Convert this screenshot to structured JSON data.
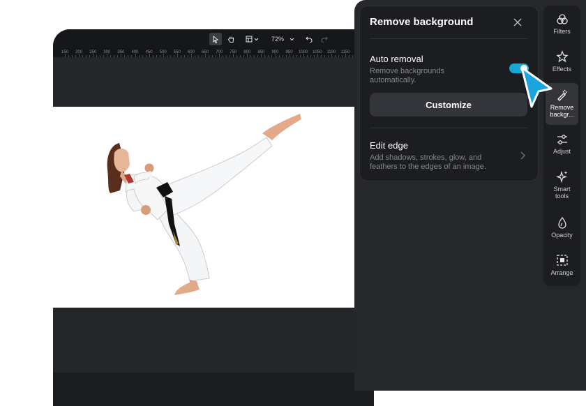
{
  "editor": {
    "zoom": "72%",
    "ruler_ticks": [
      "150",
      "200",
      "250",
      "300",
      "350",
      "400",
      "450",
      "500",
      "550",
      "600",
      "650",
      "700",
      "750",
      "800",
      "850",
      "900",
      "950",
      "1000",
      "1050",
      "1100",
      "1150"
    ]
  },
  "panel": {
    "title": "Remove background",
    "auto_removal": {
      "title": "Auto removal",
      "description_line1": "Remove backgrounds",
      "description_line2": "automatically.",
      "toggle_on": true
    },
    "customize_label": "Customize",
    "edit_edge": {
      "title": "Edit edge",
      "description_line1": "Add shadows, strokes, glow, and",
      "description_line2": "feathers to the edges of an image."
    }
  },
  "rail": {
    "items": [
      {
        "label1": "Filters",
        "label2": "",
        "icon": "filters-icon"
      },
      {
        "label1": "Effects",
        "label2": "",
        "icon": "effects-icon"
      },
      {
        "label1": "Remove",
        "label2": "backgr...",
        "icon": "remove-background-icon",
        "active": true
      },
      {
        "label1": "Adjust",
        "label2": "",
        "icon": "adjust-icon"
      },
      {
        "label1": "Smart",
        "label2": "tools",
        "icon": "smart-tools-icon"
      },
      {
        "label1": "Opacity",
        "label2": "",
        "icon": "opacity-icon"
      },
      {
        "label1": "Arrange",
        "label2": "",
        "icon": "arrange-icon"
      }
    ]
  },
  "colors": {
    "accent": "#16a8d6",
    "cursor": "#1aa5e0",
    "panel_bg": "#1c1d20",
    "editor_bg": "#25262a"
  }
}
